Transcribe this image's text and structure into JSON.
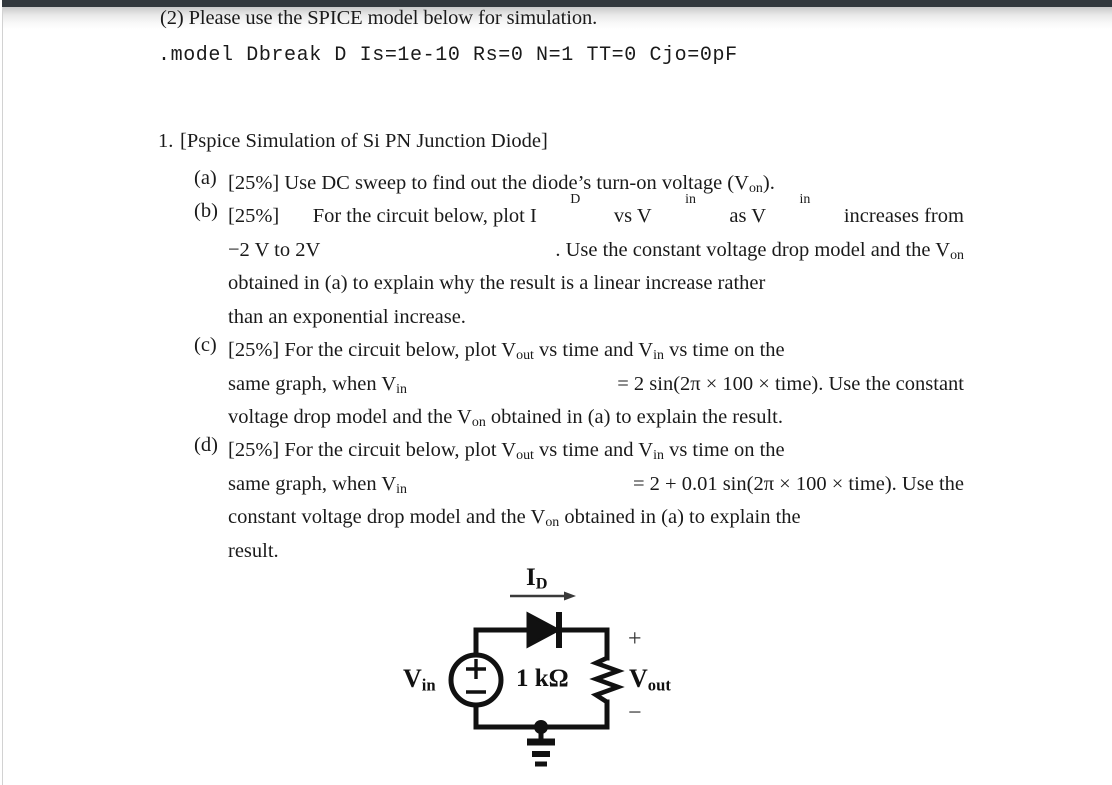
{
  "document": {
    "intro": {
      "line1": "(2) Please use the SPICE model below for simulation.",
      "spice_model": ".model Dbreak D Is=1e-10 Rs=0 N=1 TT=0 Cjo=0pF"
    },
    "item": {
      "number": "1.",
      "title": "[Pspice Simulation of Si PN Junction Diode]"
    },
    "subitems": [
      {
        "mark": "(a)",
        "weight": "[25%]",
        "text_before": " Use DC sweep to find out the diode’s turn-on voltage (V",
        "sub": "on",
        "text_after": ")."
      },
      {
        "mark": "(b)",
        "weight": "[25%]",
        "line1_a": " For the circuit below, plot I",
        "line1_sub1": "D",
        "line1_b": " vs V",
        "line1_sub2": "in",
        "line1_c": " as V",
        "line1_sub3": "in",
        "line1_d": " increases from",
        "line2_a": "−2 V to 2V",
        "line2_b": ". Use the constant voltage drop model and the V",
        "line2_sub": "on",
        "line3": "obtained in (a) to explain why the result is a linear increase rather",
        "line4": "than an exponential increase."
      },
      {
        "mark": "(c)",
        "weight": "[25%]",
        "line1_a": " For the circuit below, plot V",
        "line1_sub1": "out",
        "line1_b": " vs time and V",
        "line1_sub2": "in",
        "line1_c": " vs time on the",
        "line2_a": "same graph, when V",
        "line2_sub": "in",
        "line2_b": " = 2 sin(2π × 100 × time). Use the constant",
        "line3_a": "voltage drop model and the V",
        "line3_sub": "on",
        "line3_b": " obtained in (a) to explain the result."
      },
      {
        "mark": "(d)",
        "weight": "[25%]",
        "line1_a": " For the circuit below, plot V",
        "line1_sub1": "out",
        "line1_b": " vs time and V",
        "line1_sub2": "in",
        "line1_c": " vs time on the",
        "line2_a": "same graph, when V",
        "line2_sub": "in",
        "line2_b": " = 2 + 0.01 sin(2π × 100 × time). Use the",
        "line3_a": "constant voltage drop model and the V",
        "line3_sub": "on",
        "line3_b": " obtained in (a) to explain the",
        "line4": "result."
      }
    ],
    "circuit": {
      "current_label": "I",
      "current_label_sub": "D",
      "source_label": "V",
      "source_label_sub": "in",
      "source_plus": "+",
      "source_minus": "−",
      "resistor_label": "1 kΩ",
      "output_label": "V",
      "output_label_sub": "out",
      "output_plus": "+",
      "output_minus": "−"
    }
  },
  "colors": {
    "topbar": "#32383d",
    "ink": "#111111",
    "page": "#ffffff"
  }
}
